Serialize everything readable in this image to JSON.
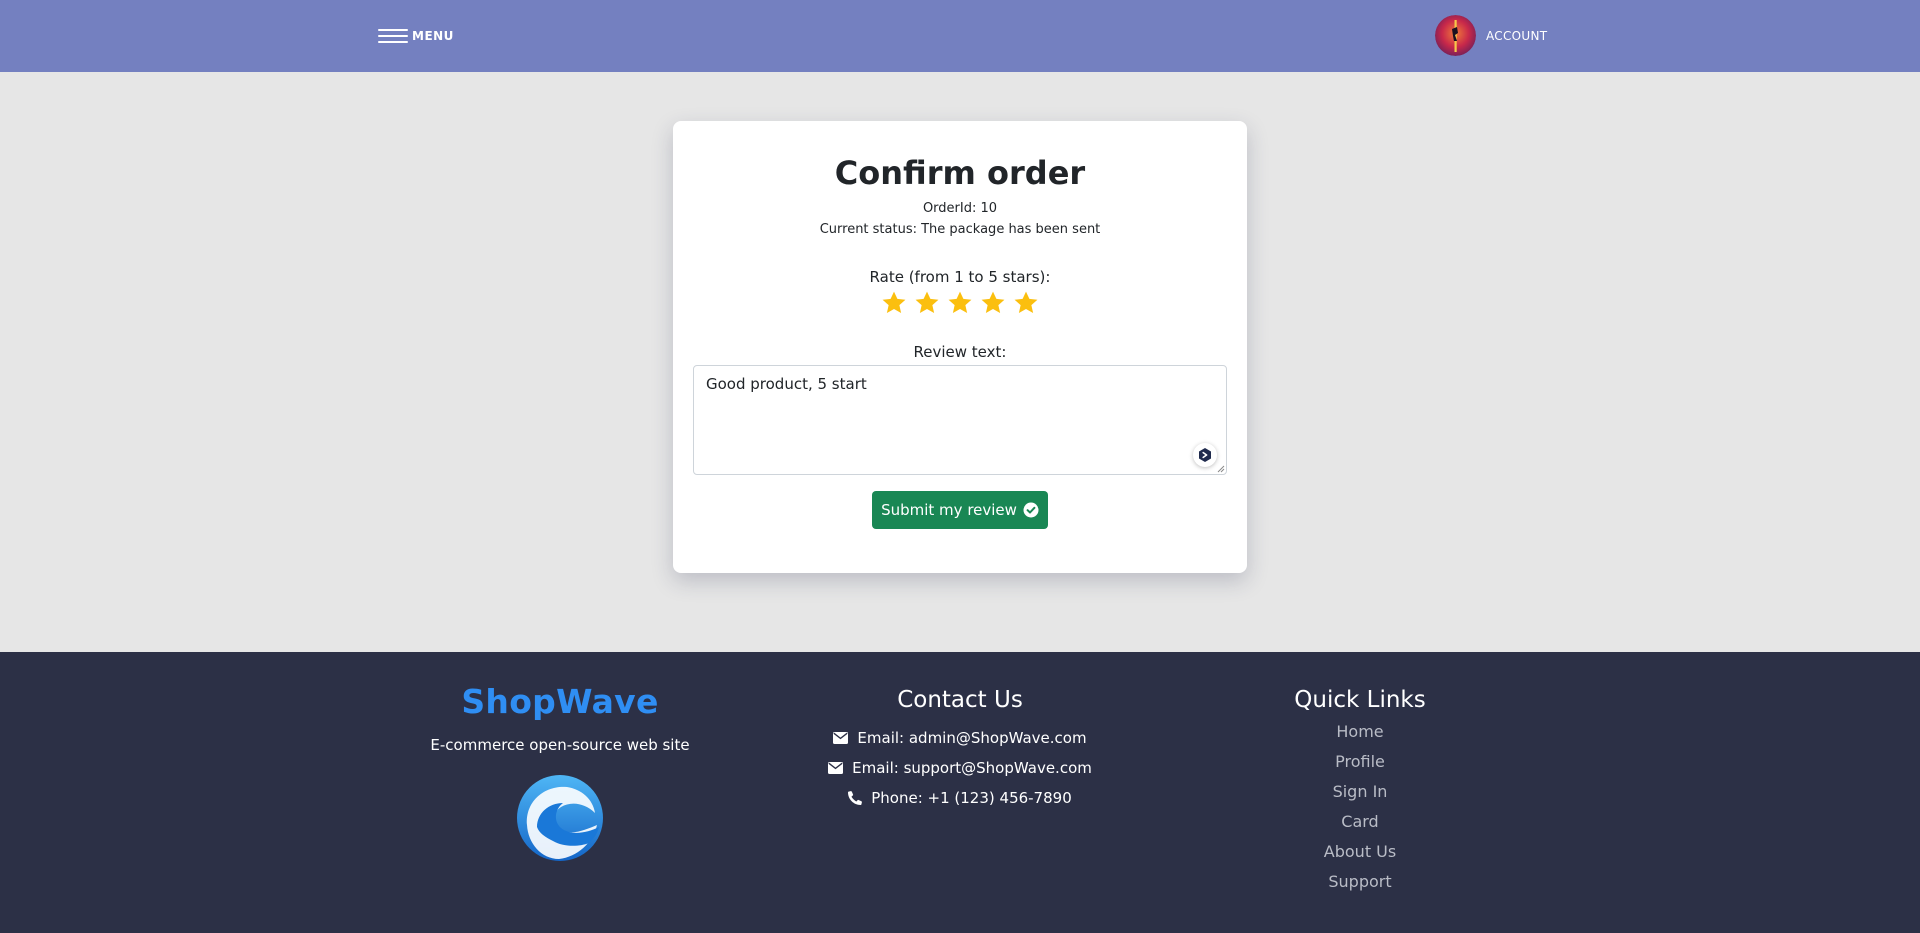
{
  "header": {
    "menu_label": "MENU",
    "account_label": "ACCOUNT"
  },
  "order": {
    "title": "Confirm order",
    "order_id": "OrderId: 10",
    "status": "Current status: The package has been sent",
    "rate_label": "Rate (from 1 to 5 stars):",
    "rating": 5,
    "max_rating": 5,
    "review_label": "Review text:",
    "review_text": "Good product, 5 start",
    "submit_label": "Submit my review"
  },
  "footer": {
    "brand": {
      "name": "ShopWave",
      "tagline": "E-commerce open-source web site"
    },
    "contact": {
      "heading": "Contact Us",
      "lines": [
        {
          "icon": "envelope-icon",
          "text": "Email: admin@ShopWave.com"
        },
        {
          "icon": "envelope-icon",
          "text": "Email: support@ShopWave.com"
        },
        {
          "icon": "phone-icon",
          "text": "Phone: +1 (123) 456-7890"
        }
      ]
    },
    "links": {
      "heading": "Quick Links",
      "items": [
        "Home",
        "Profile",
        "Sign In",
        "Card",
        "About Us",
        "Support"
      ]
    }
  },
  "colors": {
    "header_bg": "#7480c0",
    "page_bg": "#e6e6e6",
    "footer_bg": "#2c3046",
    "brand_blue": "#2f8ef3",
    "star": "#fbbf0f",
    "submit": "#198754"
  }
}
